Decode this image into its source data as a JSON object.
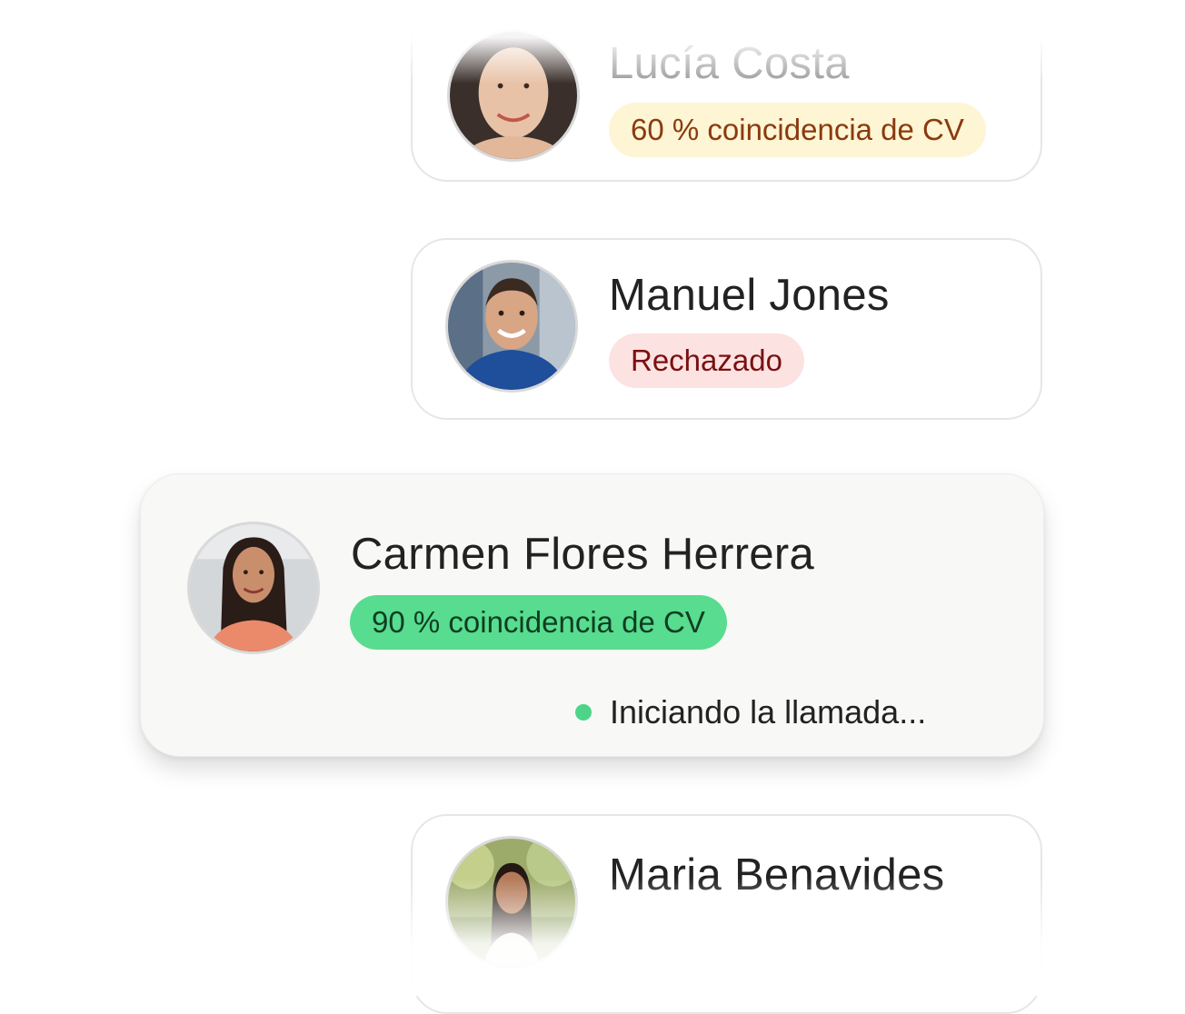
{
  "candidates": [
    {
      "name": "Lucía Costa",
      "badge": "60 % coincidencia de CV",
      "badge_type": "match",
      "badge_bg": "#fdf5d3",
      "badge_color": "#8a3a0f",
      "avatar_icon": "person-photo-avatar"
    },
    {
      "name": "Manuel Jones",
      "badge": "Rechazado",
      "badge_type": "rejected",
      "badge_bg": "#fde2e2",
      "badge_color": "#7a1010",
      "avatar_icon": "person-photo-avatar"
    },
    {
      "name": "Carmen Flores Herrera",
      "badge": "90 % coincidencia de CV",
      "badge_type": "match",
      "badge_bg": "#58dc8f",
      "badge_color": "#0e3d22",
      "status": "Iniciando la llamada...",
      "status_color": "#4ed488",
      "highlighted": true,
      "avatar_icon": "person-photo-avatar"
    },
    {
      "name": "Maria Benavides",
      "avatar_icon": "person-photo-avatar"
    }
  ]
}
